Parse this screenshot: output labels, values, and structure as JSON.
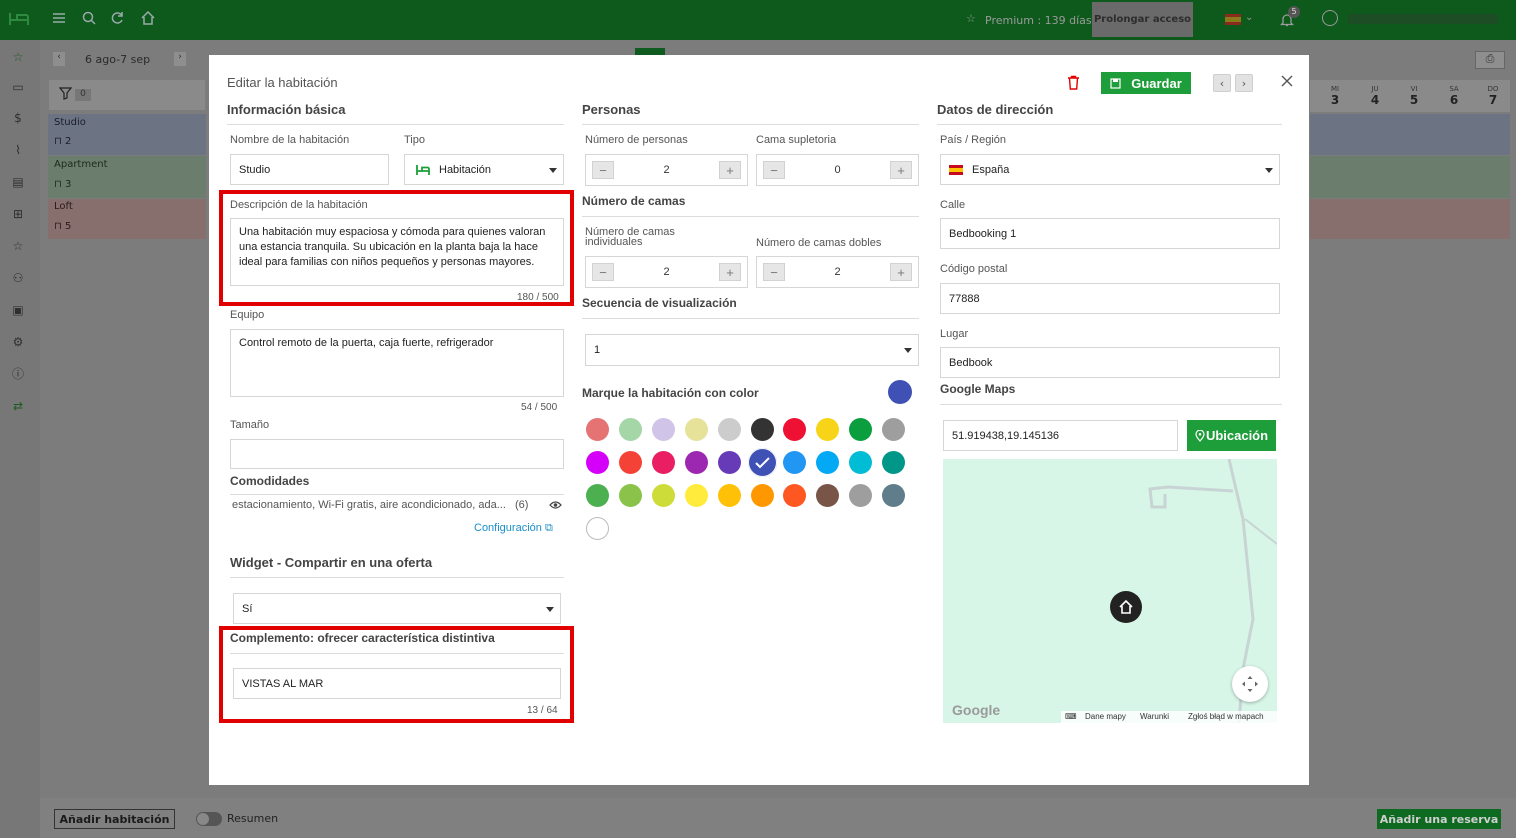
{
  "topbar": {
    "premium_label": "Premium : 139 días",
    "extend_button": "Prolongar acceso",
    "notifications_count": "5"
  },
  "calendar": {
    "date_range": "6 ago-7 sep",
    "filter_count": "0",
    "days": [
      {
        "abbr": "MI",
        "num": "3"
      },
      {
        "abbr": "JU",
        "num": "4"
      },
      {
        "abbr": "VI",
        "num": "5"
      },
      {
        "abbr": "SA",
        "num": "6"
      },
      {
        "abbr": "DO",
        "num": "7"
      }
    ],
    "rooms": [
      {
        "name": "Studio",
        "count": "2"
      },
      {
        "name": "Apartment",
        "count": "3"
      },
      {
        "name": "Loft",
        "count": "5"
      }
    ]
  },
  "bottom": {
    "add_room": "Añadir habitación",
    "summary_toggle": "Resumen",
    "add_booking": "Añadir una reserva"
  },
  "modal": {
    "title": "Editar la habitación",
    "save": "Guardar",
    "basic": {
      "section": "Información básica",
      "name_label": "Nombre de la habitación",
      "name_value": "Studio",
      "type_label": "Tipo",
      "type_value": "Habitación",
      "desc_label": "Descripción de la habitación",
      "desc_value": "Una habitación muy espaciosa y cómoda para quienes valoran una estancia tranquila. Su ubicación en la planta baja la hace ideal para familias con niños pequeños y personas mayores.",
      "desc_counter": "180 / 500",
      "equip_label": "Equipo",
      "equip_value": "Control remoto de la puerta, caja fuerte, refrigerador",
      "equip_counter": "54 / 500",
      "size_label": "Tamaño",
      "size_value": "",
      "amenities_label": "Comodidades",
      "amenities_value": "estacionamiento, Wi-Fi gratis, aire acondicionado, ada...",
      "amenities_count": "(6)",
      "config_link": "Configuración",
      "widget_section": "Widget - Compartir en una oferta",
      "widget_value": "Sí",
      "addon_section": "Complemento: ofrecer característica distintiva",
      "addon_value": "VISTAS AL MAR",
      "addon_counter": "13 / 64"
    },
    "persons": {
      "section": "Personas",
      "num_persons_label": "Número de personas",
      "num_persons": "2",
      "extra_bed_label": "Cama supletoria",
      "extra_bed": "0",
      "beds_section": "Número de camas",
      "single_label": "Número de camas individuales",
      "single": "2",
      "double_label": "Número de camas dobles",
      "double": "2",
      "seq_section": "Secuencia de visualización",
      "seq_value": "1",
      "color_section": "Marque la habitación con color",
      "selected_color": "#3f51b5",
      "colors": [
        "#e57373",
        "#a5d6a7",
        "#d1c4e9",
        "#e6e29a",
        "#cccccc",
        "#333333",
        "#ee1133",
        "#f7d417",
        "#0b9e3e",
        "#9e9e9e",
        "#d500f9",
        "#f44336",
        "#e91e63",
        "#9c27b0",
        "#673ab7",
        "#3f51b5",
        "#2196f3",
        "#03a9f4",
        "#00bcd4",
        "#009688",
        "#4caf50",
        "#8bc34a",
        "#cddc39",
        "#ffeb3b",
        "#ffc107",
        "#ff9800",
        "#ff5722",
        "#795548",
        "#9e9e9e",
        "#607d8b",
        "#ffffff"
      ]
    },
    "address": {
      "section": "Datos de dirección",
      "country_label": "País / Región",
      "country_value": "España",
      "street_label": "Calle",
      "street_value": "Bedbooking 1",
      "postal_label": "Código postal",
      "postal_value": "77888",
      "place_label": "Lugar",
      "place_value": "Bedbook",
      "maps_section": "Google Maps",
      "coords_value": "51.919438,19.145136",
      "location_button": "Ubicación",
      "map_brand": "Google",
      "map_data": "Dane mapy",
      "map_terms": "Warunki",
      "map_report": "Zgłoś błąd w mapach"
    }
  }
}
